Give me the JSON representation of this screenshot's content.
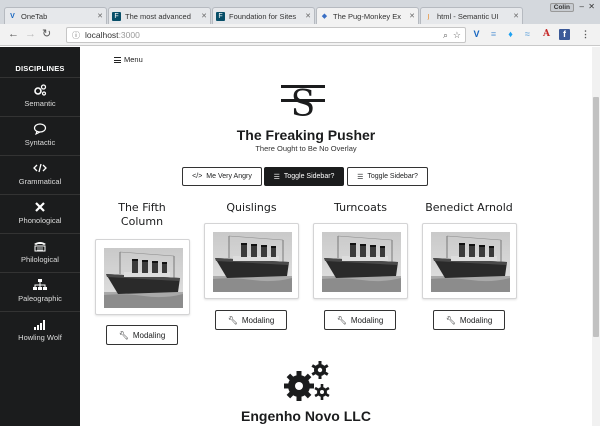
{
  "browser": {
    "tabs": [
      {
        "label": "OneTab",
        "favicon": "onetab-icon",
        "active": false
      },
      {
        "label": "The most advanced",
        "favicon": "foundation-icon",
        "active": false
      },
      {
        "label": "Foundation for Sites",
        "favicon": "foundation-icon",
        "active": false
      },
      {
        "label": "The Pug-Monkey Ex",
        "favicon": "pug-icon",
        "active": true
      },
      {
        "label": "html - Semantic UI",
        "favicon": "stackoverflow-icon",
        "active": false
      }
    ],
    "profile": "Colin",
    "url_host": "localhost",
    "url_port": ":3000"
  },
  "sidebar": {
    "heading": "DISCIPLINES",
    "items": [
      {
        "label": "Semantic",
        "icon": "cogs-icon"
      },
      {
        "label": "Syntactic",
        "icon": "comment-icon"
      },
      {
        "label": "Grammatical",
        "icon": "code-icon"
      },
      {
        "label": "Phonological",
        "icon": "x-icon"
      },
      {
        "label": "Philological",
        "icon": "tty-icon"
      },
      {
        "label": "Paleographic",
        "icon": "sitemap-icon"
      },
      {
        "label": "Howling Wolf",
        "icon": "signal-icon"
      }
    ]
  },
  "main": {
    "menu_label": "Menu",
    "logo_letter": "S",
    "title": "The Freaking Pusher",
    "subtitle": "There Ought to Be No Overlay",
    "buttons": {
      "angry": "Me Very Angry",
      "toggle1": "Toggle Sidebar?",
      "toggle2": "Toggle Sidebar?"
    },
    "cards": [
      {
        "title_line1": "The Fifth",
        "title_line2": "Column",
        "button": "Modaling"
      },
      {
        "title_line1": "Quislings",
        "title_line2": "",
        "button": "Modaling"
      },
      {
        "title_line1": "Turncoats",
        "title_line2": "",
        "button": "Modaling"
      },
      {
        "title_line1": "Benedict Arnold",
        "title_line2": "",
        "button": "Modaling"
      }
    ],
    "company": "Engenho Novo LLC"
  }
}
